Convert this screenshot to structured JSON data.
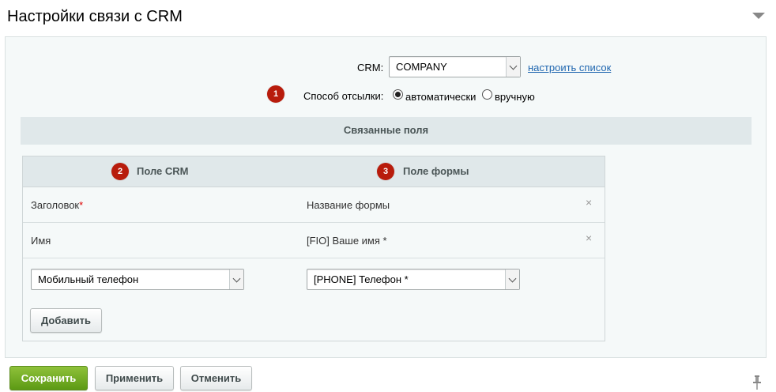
{
  "header": {
    "title": "Настройки связи с CRM"
  },
  "settings": {
    "crm_label": "CRM:",
    "crm_value": "COMPANY",
    "config_link": "настроить список",
    "send_method_label": "Способ отсылки:",
    "send_options": [
      {
        "label": "автоматически",
        "selected": true
      },
      {
        "label": "вручную",
        "selected": false
      }
    ],
    "badge_1": "1"
  },
  "linked_fields": {
    "title": "Связанные поля",
    "columns": [
      {
        "badge": "2",
        "label": "Поле CRM"
      },
      {
        "badge": "3",
        "label": "Поле формы"
      }
    ],
    "rows": [
      {
        "crm_field": "Заголовок",
        "required_mark": "*",
        "form_field": "Название формы",
        "remove": "×"
      },
      {
        "crm_field": "Имя",
        "required_mark": "",
        "form_field": "[FIO] Ваше имя *",
        "remove": "×"
      }
    ],
    "new_row": {
      "crm_select": "Мобильный телефон",
      "form_select": "[PHONE] Телефон *"
    },
    "add_button": "Добавить"
  },
  "footer": {
    "save": "Сохранить",
    "apply": "Применить",
    "cancel": "Отменить"
  },
  "colors": {
    "badge": "#b81c0c",
    "save_button": "#6aa51f",
    "link": "#2067b0",
    "section_bar": "#e0e8ea"
  }
}
